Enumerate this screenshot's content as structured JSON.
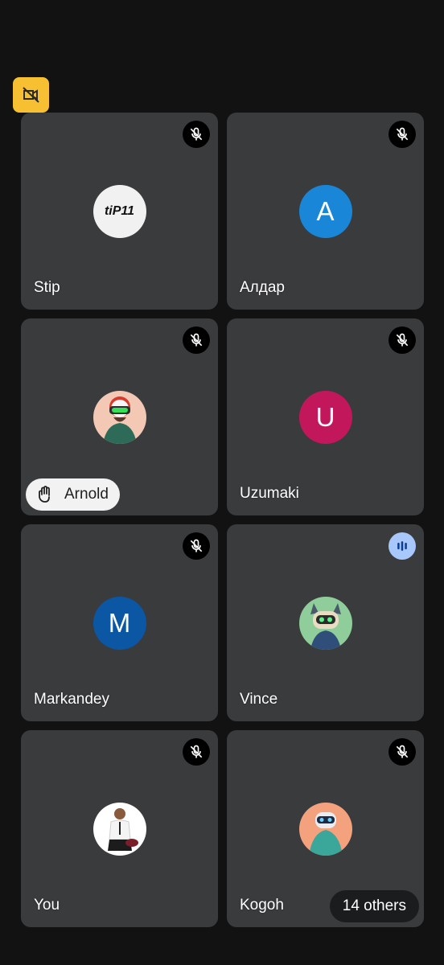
{
  "colors": {
    "background": "#121212",
    "tile": "#3a3b3d",
    "camera_off_badge": "#f7c033",
    "speaking_badge": "#a8c7fa"
  },
  "camera_off_icon": "video-off-icon",
  "participants": [
    {
      "name": "Stip",
      "avatar_type": "image",
      "avatar_text": "tiP11",
      "status_icon": "mic-off-icon"
    },
    {
      "name": "Алдар",
      "avatar_type": "letter",
      "avatar_text": "A",
      "avatar_color": "#1a86d8",
      "status_icon": "mic-off-icon"
    },
    {
      "name": "Arnold",
      "avatar_type": "image",
      "status_icon": "mic-off-icon",
      "hand_raised": true,
      "hand_icon": "raised-hand-icon"
    },
    {
      "name": "Uzumaki",
      "avatar_type": "letter",
      "avatar_text": "U",
      "avatar_color": "#c2185b",
      "status_icon": "mic-off-icon"
    },
    {
      "name": "Markandey",
      "avatar_type": "letter",
      "avatar_text": "M",
      "avatar_color": "#0b57a4",
      "status_icon": "mic-off-icon"
    },
    {
      "name": "Vince",
      "avatar_type": "image",
      "status_icon": "speaking-icon"
    },
    {
      "name": "You",
      "avatar_type": "image",
      "status_icon": "mic-off-icon"
    },
    {
      "name": "Kogoh",
      "avatar_type": "image",
      "status_icon": "mic-off-icon"
    }
  ],
  "others_label": "14 others"
}
